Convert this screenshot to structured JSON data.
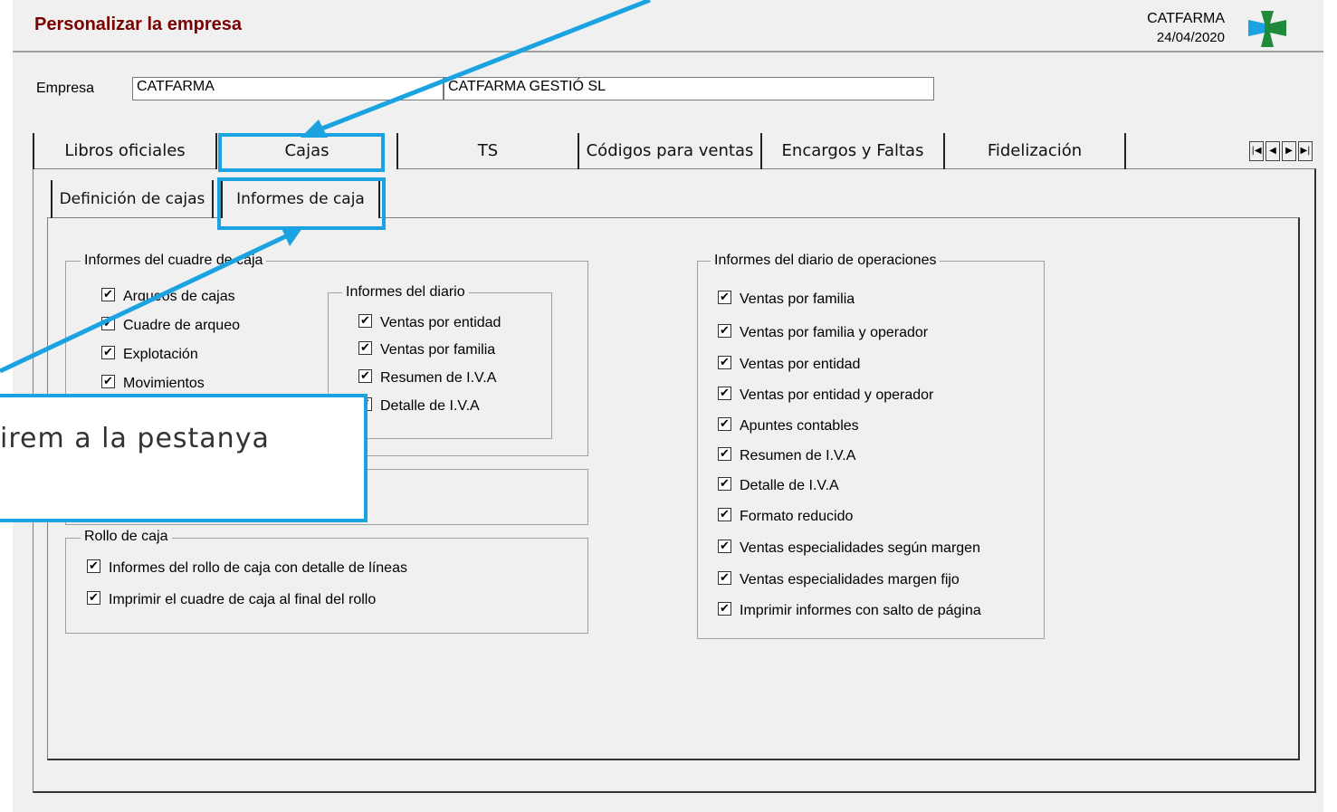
{
  "window": {
    "title": "Personalizar la empresa",
    "company_code": "CATFARMA",
    "date": "24/04/2020"
  },
  "empresa": {
    "label": "Empresa",
    "code": "CATFARMA",
    "name": "CATFARMA GESTIÓ SL"
  },
  "tabs": [
    "Libros oficiales",
    "Cajas",
    "TS",
    "Códigos para ventas",
    "Encargos y Faltas",
    "Fidelización"
  ],
  "subtabs": [
    "Definición de cajas",
    "Informes de caja"
  ],
  "groups": {
    "cuadre": {
      "title": "Informes del cuadre de caja",
      "items": [
        "Arqueos de cajas",
        "Cuadre de arqueo",
        "Explotación",
        "Movimientos"
      ]
    },
    "diario": {
      "title": "Informes del diario",
      "items": [
        "Ventas por entidad",
        "Ventas por familia",
        "Resumen de I.V.A",
        "Detalle de I.V.A"
      ]
    },
    "rollo": {
      "title": "Rollo de caja",
      "items": [
        "Informes del rollo de caja con detalle de líneas",
        "Imprimir el cuadre de caja al final del rollo"
      ]
    },
    "operaciones": {
      "title": "Informes del diario de operaciones",
      "items": [
        "Ventas por familia",
        "Ventas por familia y operador",
        "Ventas por entidad",
        "Ventas por entidad y operador",
        "Apuntes contables",
        "Resumen de I.V.A",
        "Detalle de I.V.A",
        "Formato reducido",
        "Ventas especialidades según margen",
        "Ventas especialidades margen fijo",
        "Imprimir informes con salto de página"
      ]
    }
  },
  "callout": {
    "text": "irem a la pestanya"
  },
  "colors": {
    "accent": "#1aa3e0",
    "title": "#7a0000",
    "logo": "#1f8a3a"
  }
}
